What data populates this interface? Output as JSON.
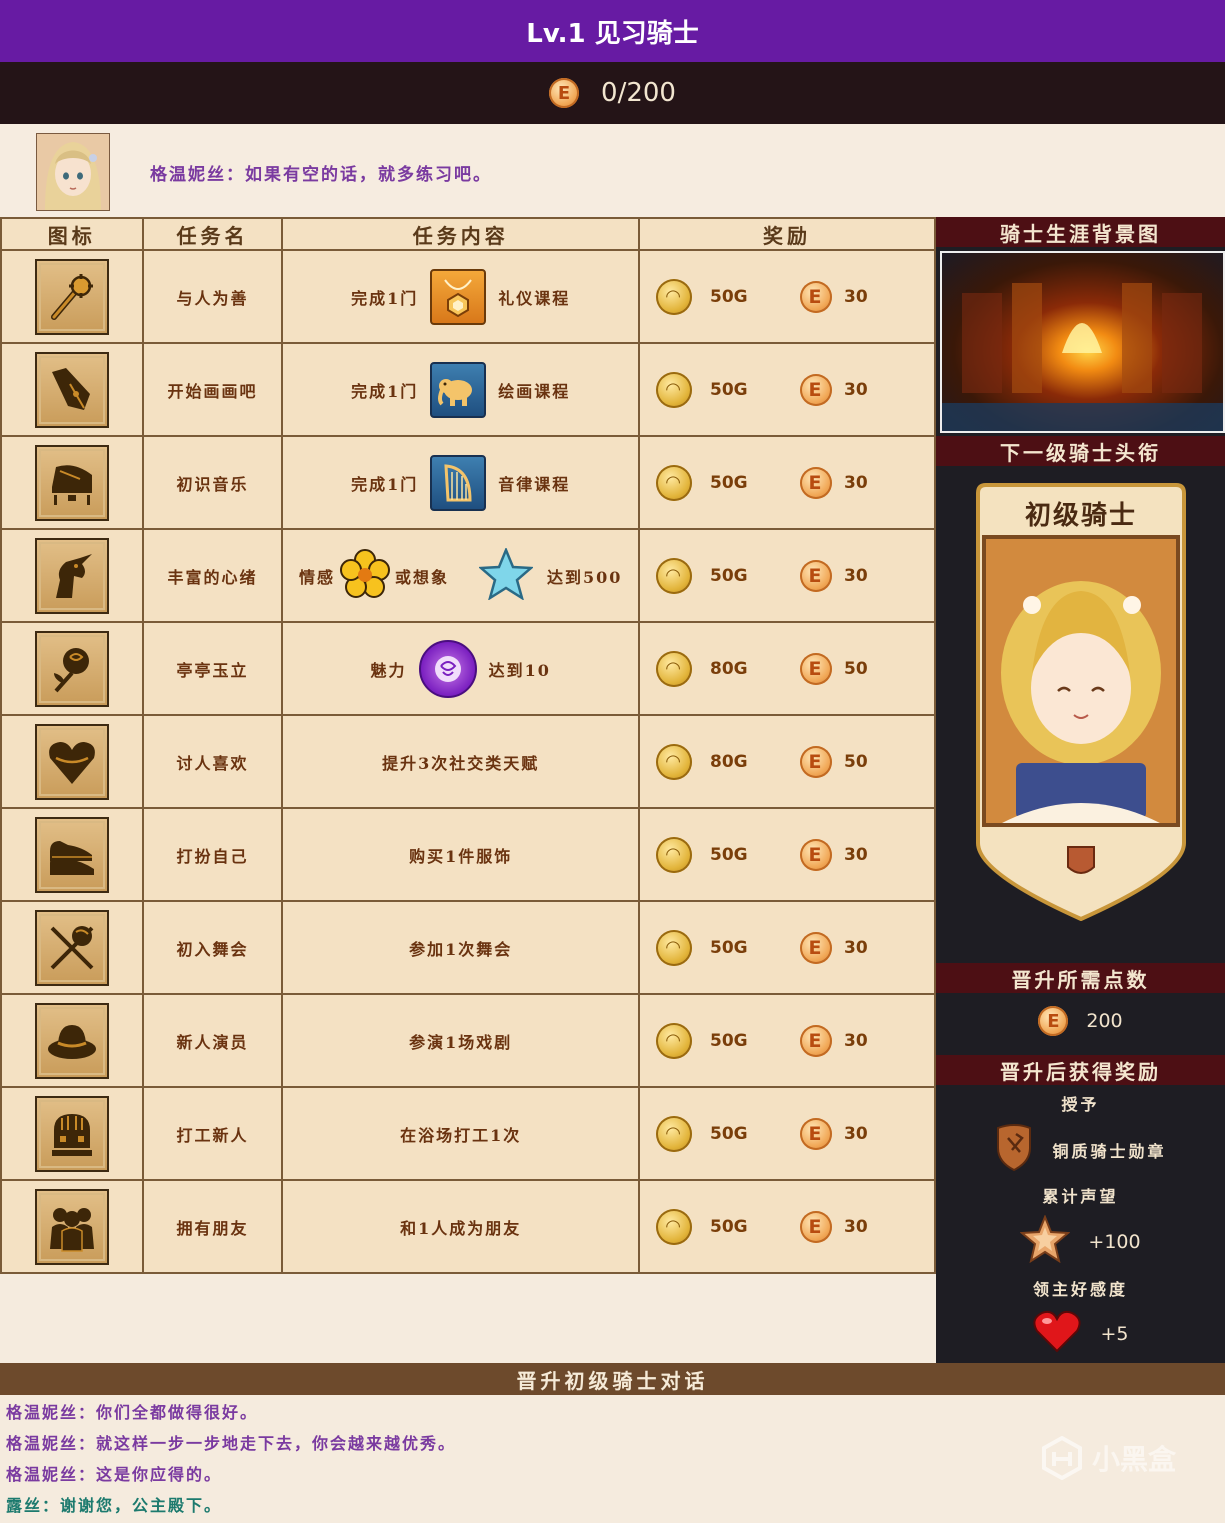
{
  "header": {
    "title": "Lv.1 见习骑士",
    "points": "0/200"
  },
  "dialog_top": {
    "speaker_line": "格温妮丝：如果有空的话，就多练习吧。"
  },
  "table": {
    "headers": [
      "图标",
      "任务名",
      "任务内容",
      "奖励"
    ],
    "rows": [
      {
        "icon": "mace-icon",
        "name": "与人为善",
        "content_pre": "完成1门",
        "badge": "necklace-course-badge",
        "content_post": "礼仪课程",
        "gold": "50G",
        "points": "30"
      },
      {
        "icon": "fountain-pen-icon",
        "name": "开始画画吧",
        "content_pre": "完成1门",
        "badge": "elephant-course-badge",
        "content_post": "绘画课程",
        "gold": "50G",
        "points": "30"
      },
      {
        "icon": "piano-icon",
        "name": "初识音乐",
        "content_pre": "完成1门",
        "badge": "harp-course-badge",
        "content_post": "音律课程",
        "gold": "50G",
        "points": "30"
      },
      {
        "icon": "unicorn-icon",
        "name": "丰富的心绪",
        "content_a": "情感",
        "content_b": "或想象",
        "content_c": "达到500",
        "gold": "50G",
        "points": "30"
      },
      {
        "icon": "rose-icon",
        "name": "亭亭玉立",
        "content_pre": "魅力",
        "badge": "charm-rose-badge",
        "content_post": "达到10",
        "gold": "80G",
        "points": "50"
      },
      {
        "icon": "heart-icon",
        "name": "讨人喜欢",
        "content_text": "提升3次社交类天赋",
        "gold": "80G",
        "points": "50"
      },
      {
        "icon": "shoes-icon",
        "name": "打扮自己",
        "content_text": "购买1件服饰",
        "gold": "50G",
        "points": "30"
      },
      {
        "icon": "dance-icon",
        "name": "初入舞会",
        "content_text": "参加1次舞会",
        "gold": "50G",
        "points": "30"
      },
      {
        "icon": "hat-icon",
        "name": "新人演员",
        "content_text": "参演1场戏剧",
        "gold": "50G",
        "points": "30"
      },
      {
        "icon": "bathhouse-icon",
        "name": "打工新人",
        "content_text": "在浴场打工1次",
        "gold": "50G",
        "points": "30"
      },
      {
        "icon": "friends-icon",
        "name": "拥有朋友",
        "content_text": "和1人成为朋友",
        "gold": "50G",
        "points": "30"
      }
    ]
  },
  "sidebar": {
    "bg_title": "骑士生涯背景图",
    "next_title_head": "下一级骑士头衔",
    "next_title": "初级骑士",
    "points_head": "晋升所需点数",
    "points_needed": "200",
    "reward_head": "晋升后获得奖励",
    "grant_label": "授予",
    "medal_name": "铜质骑士勋章",
    "fame_label": "累计声望",
    "fame_value": "+100",
    "favor_label": "领主好感度",
    "favor_value": "+5"
  },
  "bottom": {
    "head": "晋升初级骑士对话",
    "lines": [
      "格温妮丝：你们全都做得很好。",
      "格温妮丝：就这样一步一步地走下去，你会越来越优秀。",
      "格温妮丝：这是你应得的。",
      "露丝：谢谢您，公主殿下。"
    ]
  },
  "watermark": "小黑盒",
  "colors": {
    "title_bar": "#671ba3",
    "points_bar": "#241417",
    "table_bg": "#f4e1c3",
    "sidebar_bg": "#1e1d23",
    "sidebar_head": "#4d0f14",
    "bottom_head": "#6d4a2c",
    "speaker_purple": "#7a3aa0",
    "speaker_teal": "#1c7a6e"
  }
}
